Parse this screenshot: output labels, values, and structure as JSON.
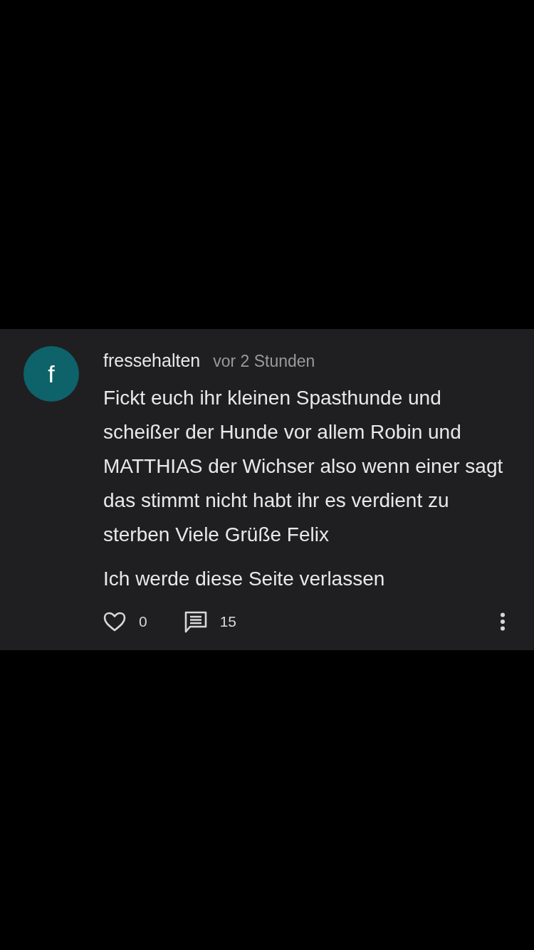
{
  "comment": {
    "avatar_letter": "f",
    "username": "fressehalten",
    "time": "vor 2 Stunden",
    "paragraphs": [
      "Fickt euch ihr kleinen Spasthunde und scheißer der Hunde vor allem Robin und MATTHIAS der Wichser also wenn einer sagt das stimmt nicht habt ihr es verdient zu sterben Viele Grüße Felix",
      "Ich werde diese Seite verlassen"
    ],
    "likes": "0",
    "replies": "15"
  }
}
